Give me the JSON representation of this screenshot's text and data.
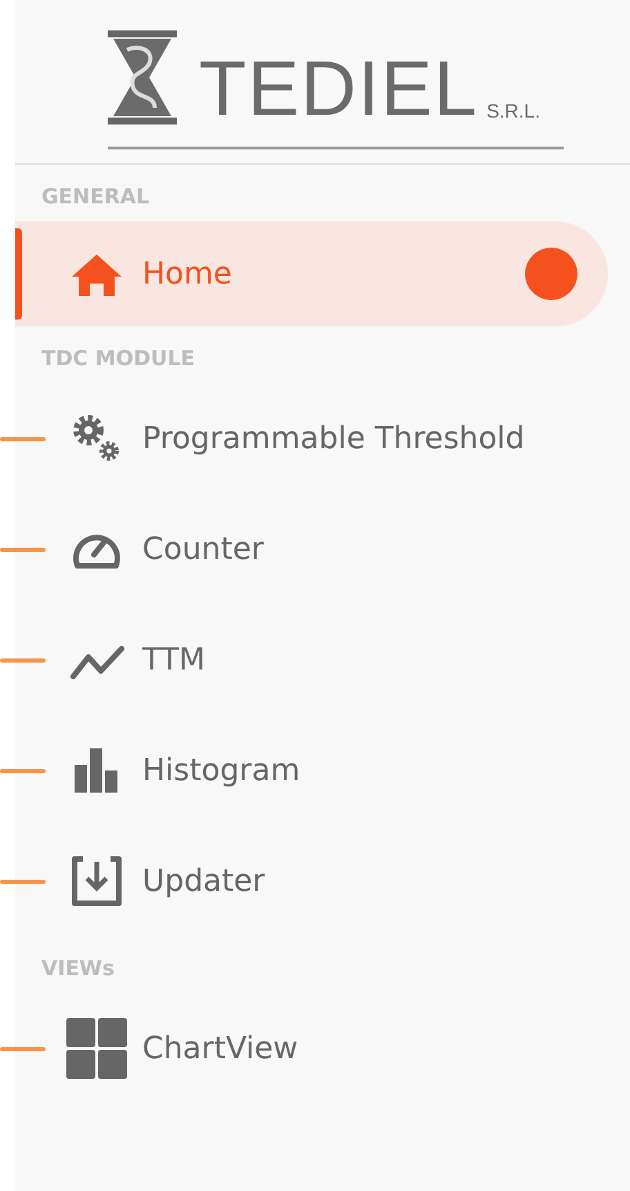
{
  "logo": {
    "name": "TEDIEL",
    "suffix": "S.R.L."
  },
  "sections": [
    {
      "title": "GENERAL",
      "items": [
        {
          "label": "Home",
          "kind": "home",
          "selected": true,
          "dot": true,
          "annotated": false
        }
      ]
    },
    {
      "title": "TDC MODULE",
      "items": [
        {
          "label": "Programmable Threshold",
          "kind": "gears",
          "selected": false,
          "dot": false,
          "annotated": true
        },
        {
          "label": "Counter",
          "kind": "gauge",
          "selected": false,
          "dot": false,
          "annotated": true
        },
        {
          "label": "TTM",
          "kind": "line",
          "selected": false,
          "dot": false,
          "annotated": true
        },
        {
          "label": "Histogram",
          "kind": "bars",
          "selected": false,
          "dot": false,
          "annotated": true
        },
        {
          "label": "Updater",
          "kind": "download",
          "selected": false,
          "dot": false,
          "annotated": true
        }
      ]
    },
    {
      "title": "VIEWs",
      "items": [
        {
          "label": "ChartView",
          "kind": "grid",
          "selected": false,
          "dot": false,
          "annotated": true
        }
      ]
    }
  ]
}
